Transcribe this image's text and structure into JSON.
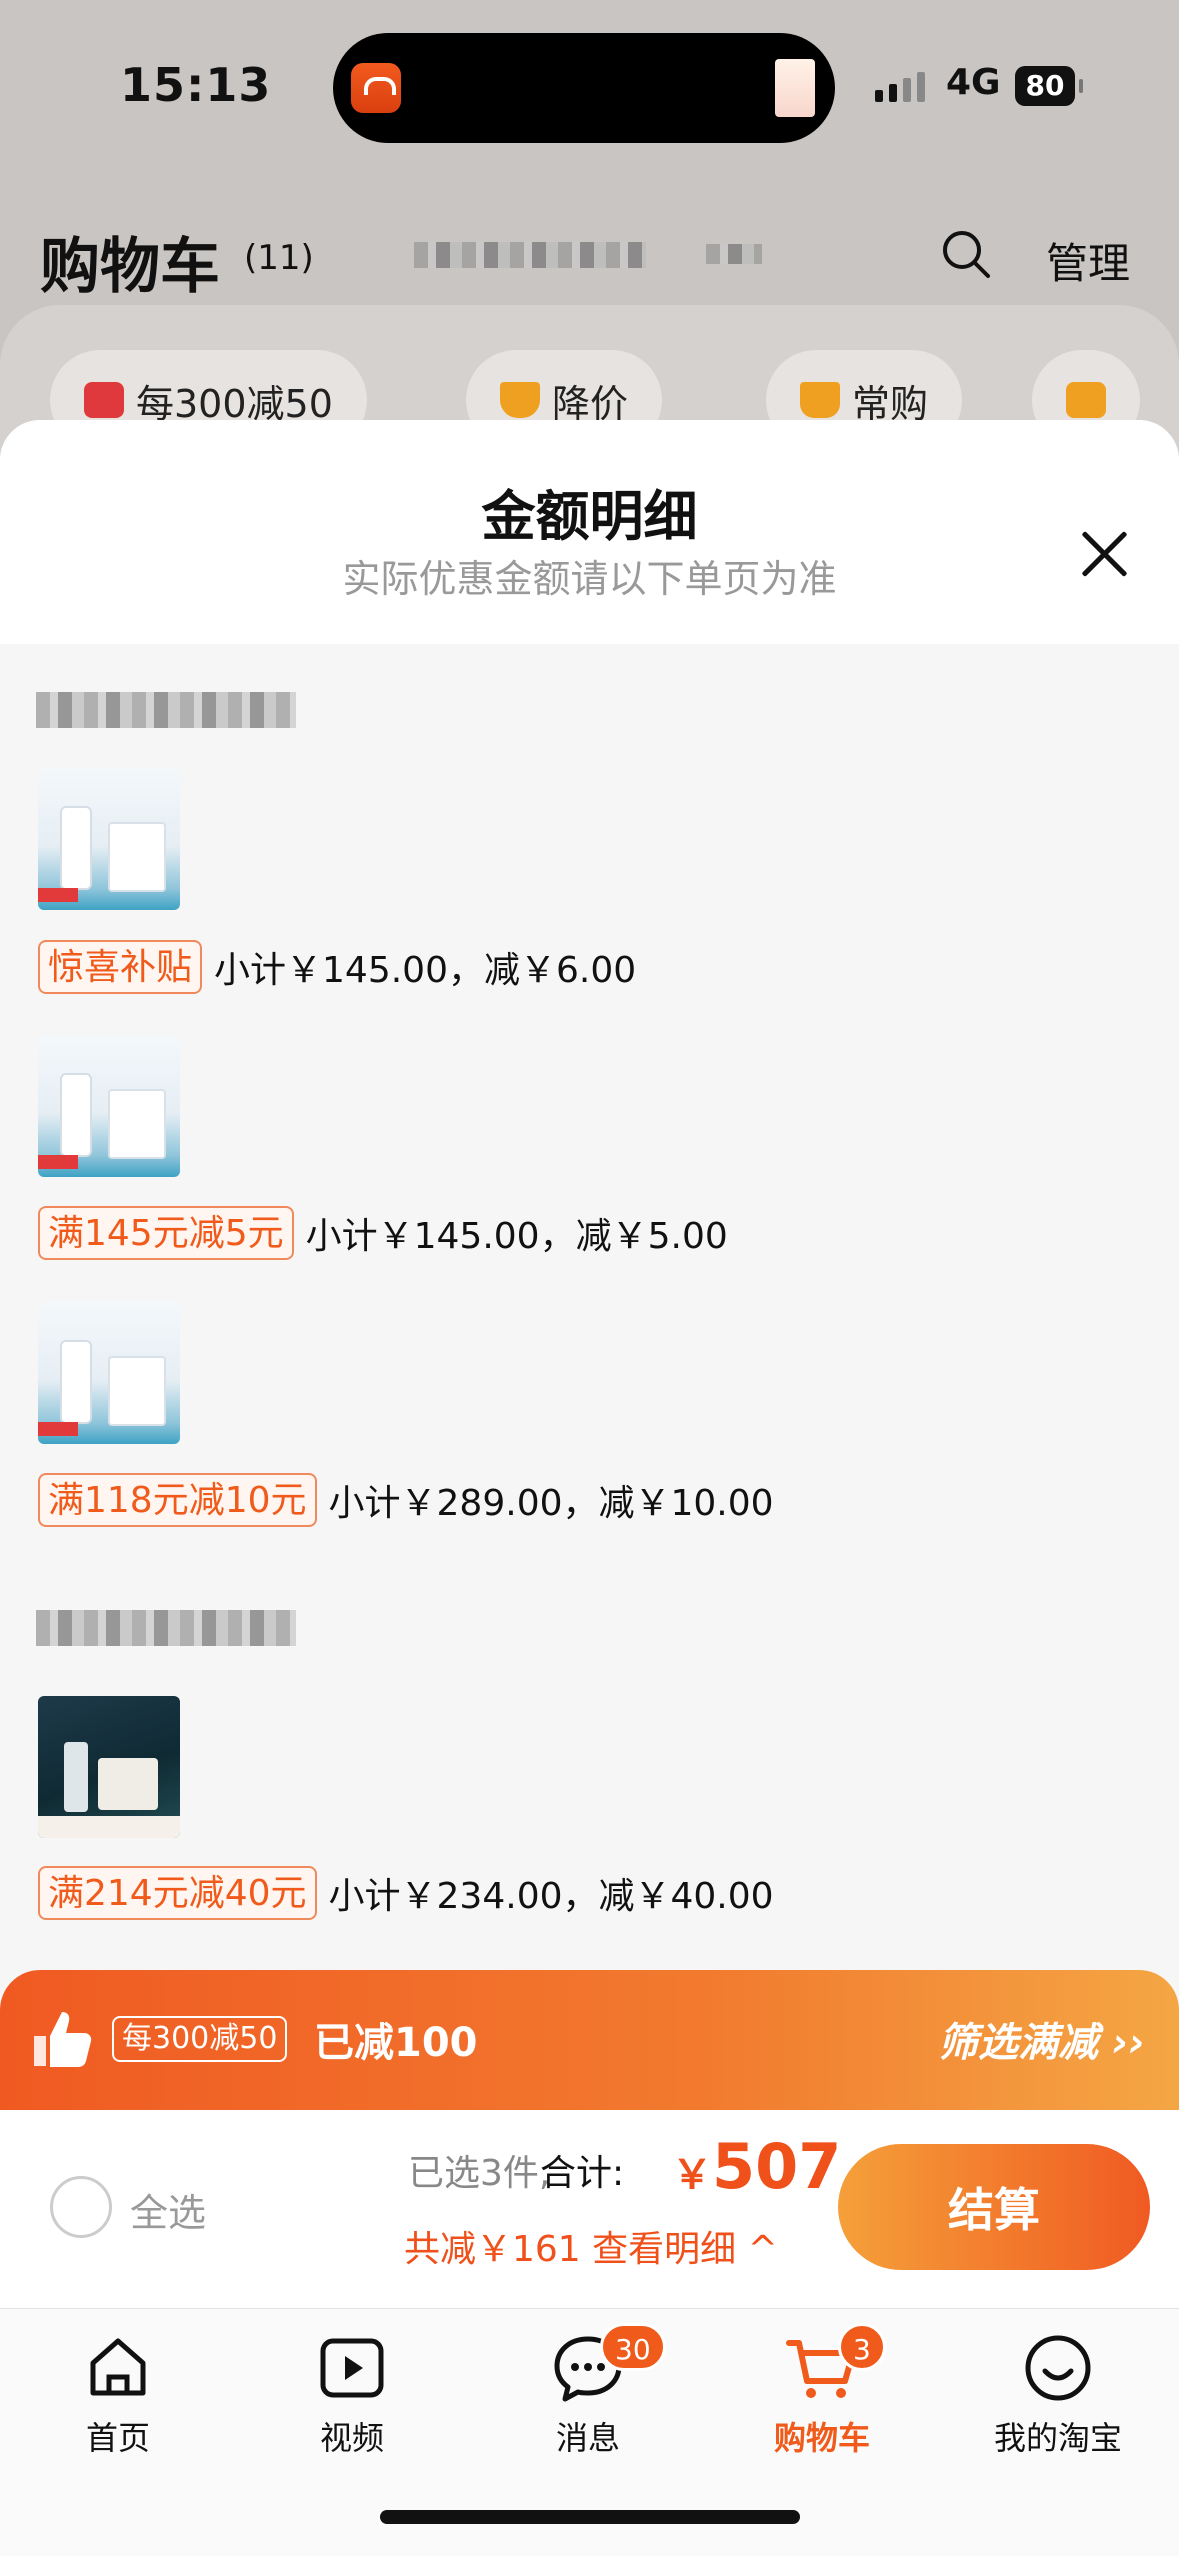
{
  "status_bar": {
    "time": "15:13",
    "network": "4G",
    "battery": "80"
  },
  "header": {
    "title": "购物车",
    "count": "(11)",
    "manage_label": "管理"
  },
  "filter_chips": [
    {
      "label": "每300减50",
      "icon": "shop-tag-icon"
    },
    {
      "label": "降价",
      "icon": "price-drop-icon"
    },
    {
      "label": "常购",
      "icon": "cart-icon"
    }
  ],
  "sheet": {
    "title": "金额明细",
    "subtitle": "实际优惠金额请以下单页为准",
    "items": [
      {
        "promo": "惊喜补贴",
        "subtotal": "小计￥145.00，减￥6.00"
      },
      {
        "promo": "满145元减5元",
        "subtotal": "小计￥145.00，减￥5.00"
      },
      {
        "promo": "满118元减10元",
        "subtotal": "小计￥289.00，减￥10.00"
      },
      {
        "promo": "满214元减40元",
        "subtotal": "小计￥234.00，减￥40.00"
      }
    ]
  },
  "promo_bar": {
    "tag": "每300减50",
    "reduced": "已减100",
    "filter": "筛选满减 ››"
  },
  "checkout": {
    "select_all": "全选",
    "selected": "已选3件,",
    "total_label": "合计:",
    "currency": "￥",
    "total": "507",
    "detail": "共减￥161 查看明细 ^",
    "button": "结算"
  },
  "tabbar": [
    {
      "label": "首页",
      "icon": "home-icon"
    },
    {
      "label": "视频",
      "icon": "video-icon"
    },
    {
      "label": "消息",
      "icon": "message-icon",
      "badge": "30"
    },
    {
      "label": "购物车",
      "icon": "cart-icon",
      "badge": "3",
      "active": true
    },
    {
      "label": "我的淘宝",
      "icon": "profile-icon"
    }
  ],
  "colors": {
    "accent": "#f05a1a",
    "promo_bar_start": "#f05a22",
    "promo_bar_end": "#f4a644"
  }
}
